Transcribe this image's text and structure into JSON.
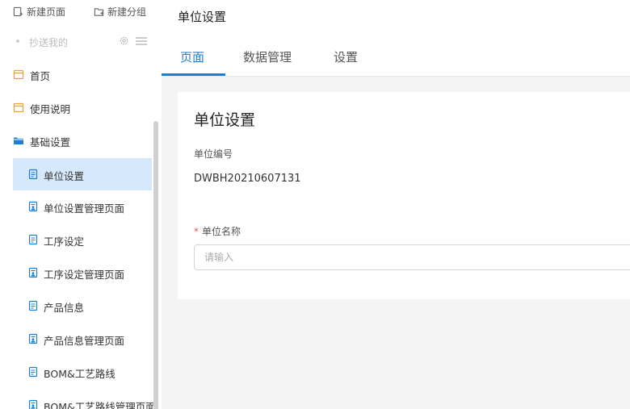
{
  "sidebar": {
    "actions": {
      "new_page": "新建页面",
      "new_group": "新建分组"
    },
    "cc_me": "抄送我的",
    "items": [
      {
        "label": "首页",
        "icon": "calendar-icon"
      },
      {
        "label": "使用说明",
        "icon": "calendar-icon"
      },
      {
        "label": "基础设置",
        "icon": "folder-open-icon"
      },
      {
        "label": "单位设置",
        "icon": "document-icon"
      },
      {
        "label": "单位设置管理页面",
        "icon": "document-user-icon"
      },
      {
        "label": "工序设定",
        "icon": "document-icon"
      },
      {
        "label": "工序设定管理页面",
        "icon": "document-user-icon"
      },
      {
        "label": "产品信息",
        "icon": "document-icon"
      },
      {
        "label": "产品信息管理页面",
        "icon": "document-user-icon"
      },
      {
        "label": "BOM&工艺路线",
        "icon": "document-icon"
      },
      {
        "label": "BOM&工艺路线管理页面",
        "icon": "document-user-icon"
      }
    ]
  },
  "header": {
    "title": "单位设置",
    "tabs": [
      {
        "label": "页面"
      },
      {
        "label": "数据管理"
      },
      {
        "label": "设置"
      }
    ]
  },
  "form": {
    "title": "单位设置",
    "unit_code_label": "单位编号",
    "unit_code_value": "DWBH20210607131",
    "required_mark": "*",
    "unit_name_label": "单位名称",
    "unit_name_placeholder": "请输入"
  },
  "colors": {
    "accent": "#1a7fd6",
    "active_bg": "#d6e8fb",
    "folder_icon": "#1a7fd6",
    "calendar_icon": "#e8a33d"
  }
}
